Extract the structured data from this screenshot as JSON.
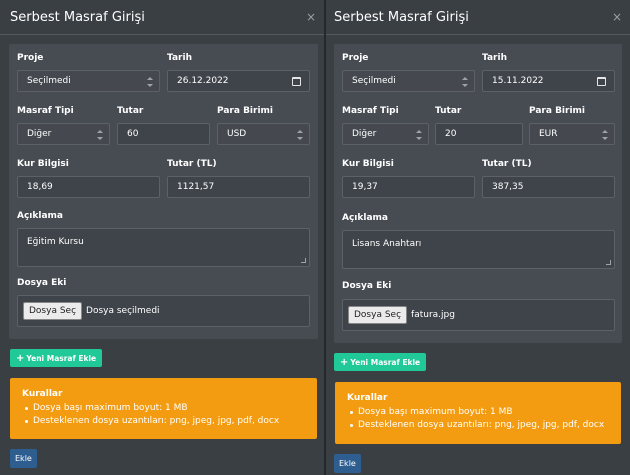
{
  "left": {
    "title": "Serbest Masraf Girişi",
    "close": "×",
    "labels": {
      "proje": "Proje",
      "tarih": "Tarih",
      "masraf_tipi": "Masraf Tipi",
      "tutar": "Tutar",
      "para_birimi": "Para Birimi",
      "kur_bilgisi": "Kur Bilgisi",
      "tutar_tl": "Tutar (TL)",
      "aciklama": "Açıklama",
      "dosya_eki": "Dosya Eki"
    },
    "values": {
      "proje": "Seçilmedi",
      "tarih": "26.12.2022",
      "masraf_tipi": "Diğer",
      "tutar": "60",
      "para_birimi": "USD",
      "kur_bilgisi": "18,69",
      "tutar_tl": "1121,57",
      "aciklama": "Eğitim Kursu"
    },
    "file_button": "Dosya Seç",
    "file_name": "Dosya seçilmedi",
    "new_expense_button": "Yeni Masraf Ekle",
    "rules": {
      "title": "Kurallar",
      "items": [
        "Dosya başı maximum boyut: 1 MB",
        "Desteklenen dosya uzantıları: png, jpeg, jpg, pdf, docx"
      ]
    },
    "add_button": "Ekle"
  },
  "right": {
    "title": "Serbest Masraf Girişi",
    "close": "×",
    "labels": {
      "proje": "Proje",
      "tarih": "Tarih",
      "masraf_tipi": "Masraf Tipi",
      "tutar": "Tutar",
      "para_birimi": "Para Birimi",
      "kur_bilgisi": "Kur Bilgisi",
      "tutar_tl": "Tutar (TL)",
      "aciklama": "Açıklama",
      "dosya_eki": "Dosya Eki"
    },
    "values": {
      "proje": "Seçilmedi",
      "tarih": "15.11.2022",
      "masraf_tipi": "Diğer",
      "tutar": "20",
      "para_birimi": "EUR",
      "kur_bilgisi": "19,37",
      "tutar_tl": "387,35",
      "aciklama": "Lisans Anahtarı"
    },
    "file_button": "Dosya Seç",
    "file_name": "fatura.jpg",
    "new_expense_button": "Yeni Masraf Ekle",
    "rules": {
      "title": "Kurallar",
      "items": [
        "Dosya başı maximum boyut: 1 MB",
        "Desteklenen dosya uzantıları: png, jpeg, jpg, pdf, docx"
      ]
    },
    "add_button": "Ekle"
  },
  "colors": {
    "background": "#2e3338",
    "panel": "#3a3f44",
    "card": "#474c53",
    "success": "#20c997",
    "warning": "#f39c12",
    "primary": "#2e5d8f"
  }
}
